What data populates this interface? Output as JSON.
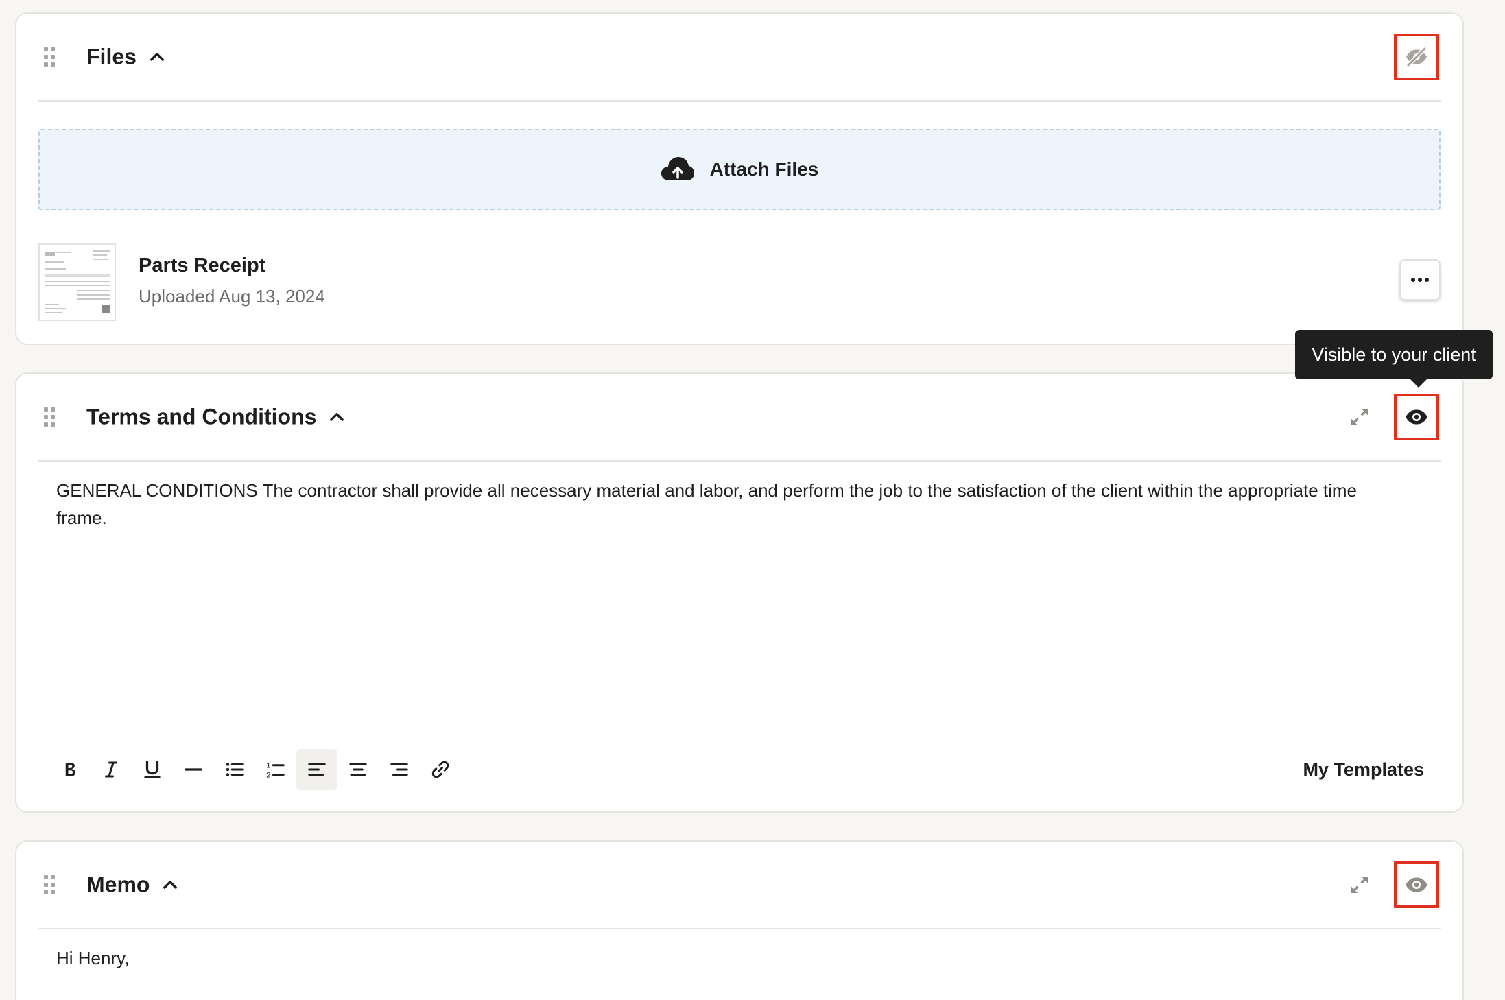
{
  "files_section": {
    "title": "Files",
    "attach_label": "Attach Files",
    "file": {
      "name": "Parts Receipt",
      "uploaded": "Uploaded Aug 13, 2024"
    },
    "visibility": "hidden"
  },
  "tooltip": {
    "text": "Visible to your client"
  },
  "terms_section": {
    "title": "Terms and Conditions",
    "body": "GENERAL CONDITIONS The contractor shall provide all necessary material and labor, and perform the job to the satisfaction of the client within the appropriate time frame.",
    "toolbar": {
      "buttons": [
        "bold",
        "italic",
        "underline",
        "horizontal-rule",
        "bullet-list",
        "numbered-list",
        "align-left",
        "align-center",
        "align-right",
        "link"
      ],
      "active": "align-left",
      "templates_label": "My Templates"
    },
    "visibility": "visible"
  },
  "memo_section": {
    "title": "Memo",
    "body": "Hi Henry,",
    "visibility": "visible"
  },
  "colors": {
    "highlight_box": "#e0301e",
    "attach_bg": "#eef4fc",
    "tooltip_bg": "#1f1f1f",
    "icon_muted": "#a7a59d"
  }
}
